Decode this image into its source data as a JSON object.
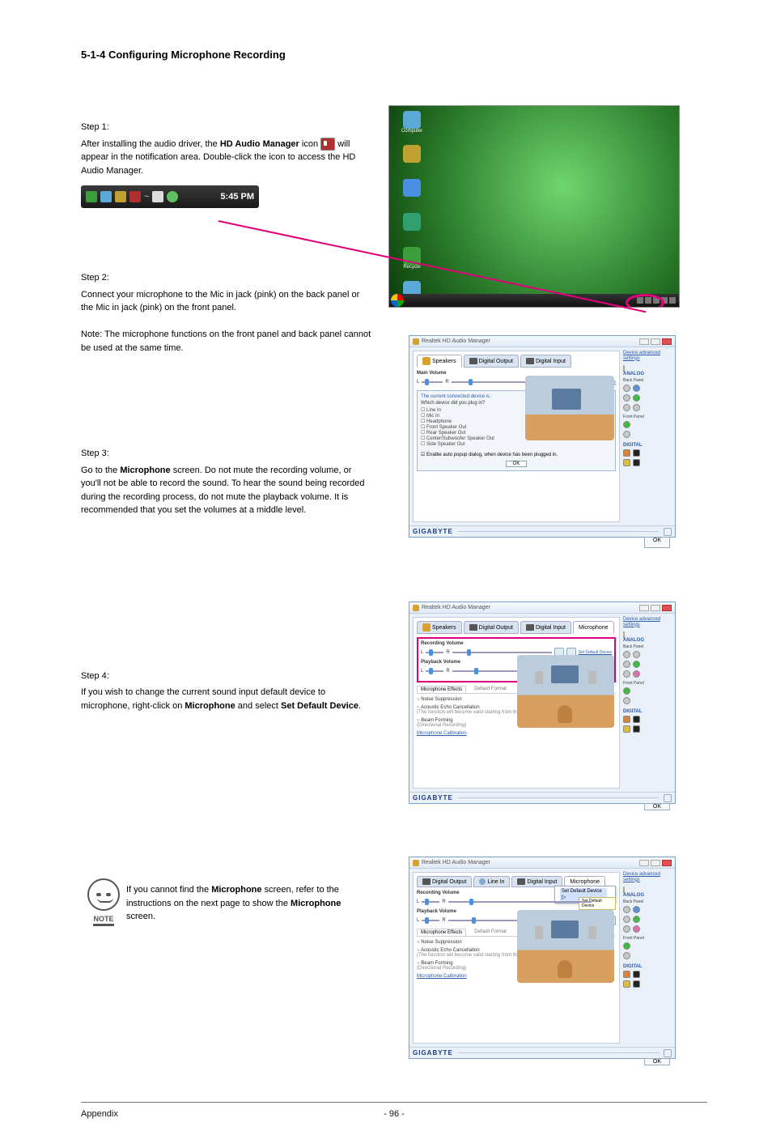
{
  "section_title": "5-1-4\tConfiguring Microphone Recording",
  "step1": {
    "title": "Step 1:",
    "prefix": "After installing the audio driver, the ",
    "bold": "HD Audio Manager",
    "mid": " icon ",
    "suffix": " will appear in the notification area. Double-click the icon to access the HD Audio Manager.",
    "time": "5:45 PM"
  },
  "step2": {
    "title": "Step 2:",
    "p1": "Connect your microphone to the Mic in jack (pink) on the back panel or the Mic in jack (pink) on the front panel.",
    "p2_a": "Note: The microphone functions on the front panel and back panel cannot be used at the same time."
  },
  "step3": {
    "title": "Step 3:",
    "p1_a": "Go to the ",
    "p1_b": "Microphone",
    "p1_c": " screen. Do not mute the recording volume, or you'll not be able to record the sound. To hear the sound being recorded during the recording process, do not mute the playback volume. It is recommended that you set the volumes at a middle level."
  },
  "step4": {
    "title": "Step 4:",
    "p1_a": "If you wish to change the current sound input default device to microphone, right-click on ",
    "p1_b": "Microphone",
    "p1_c": " and select ",
    "p1_d": "Set Default Device",
    "p1_e": "."
  },
  "note": {
    "label": "NOTE",
    "text_a": "If you cannot find the ",
    "text_b": "Microphone",
    "text_c": " screen, refer to the instructions on the next page to show the ",
    "text_d": "Microphone",
    "text_e": " screen."
  },
  "audio_manager": {
    "window_title": "Realtek HD Audio Manager",
    "tabs": {
      "speakers": "Speakers",
      "digital_output": "Digital Output",
      "digital_input": "Digital Input",
      "microphone": "Microphone",
      "line_in": "Line In"
    },
    "main_volume_label": "Main Volume",
    "recording_volume_label": "Recording Volume",
    "playback_volume_label": "Playback Volume",
    "set_default_link": "Set Default Device",
    "set_default_btn": "Set Default Device",
    "device_advanced": "Device advanced settings",
    "analog": "ANALOG",
    "back_panel": "Back Panel",
    "front_panel": "Front Panel",
    "digital": "DIGITAL",
    "logo": "GIGABYTE",
    "ok": "OK",
    "popup": {
      "title": "The current connected device is :",
      "question": "Which device did you plug in?",
      "options": [
        "Line In",
        "Mic In",
        "Headphone",
        "Front Speaker Out",
        "Rear Speaker Out",
        "Center/Subwoofer Speaker Out",
        "Side Speaker Out"
      ],
      "checkbox": "Enable auto popup dialog, when device has been plugged in."
    },
    "mic_effects": {
      "tabs": {
        "effects": "Microphone Effects",
        "format": "Default Format"
      },
      "noise": "Noise Suppression",
      "echo": "Acoustic Echo Cancellation",
      "echo_sub": "(The function will become valid starting from the next recording.)",
      "beam": "Beam Forming",
      "beam_sub": "(Directional Recording)",
      "calib": "Microphone Calibration"
    }
  },
  "footer": {
    "page": "- 96 -",
    "section": "Appendix"
  }
}
